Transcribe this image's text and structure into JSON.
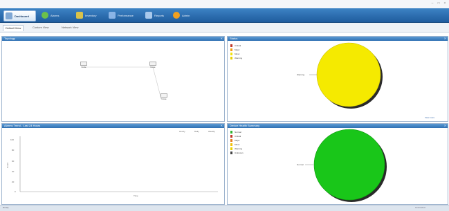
{
  "window": {
    "title_controls": [
      "–",
      "□",
      "×"
    ]
  },
  "toolbar": {
    "items": [
      {
        "label": "Dashboard",
        "icon": "dashboard-icon",
        "color": "#7fa7d4",
        "active": true
      },
      {
        "label": "Alarms",
        "icon": "alarms-icon",
        "color": "#6cc04a"
      },
      {
        "label": "Inventory",
        "icon": "inventory-icon",
        "color": "#d9c24a"
      },
      {
        "label": "Performance",
        "icon": "performance-icon",
        "color": "#8ab4e6"
      },
      {
        "label": "Reports",
        "icon": "reports-icon",
        "color": "#a9c9ec"
      },
      {
        "label": "Admin",
        "icon": "admin-icon",
        "color": "#f0a020"
      }
    ]
  },
  "subtabs": [
    "Default View",
    "Custom View",
    "Network View"
  ],
  "panels": {
    "topology": {
      "title": "Topology",
      "nodes": [
        {
          "label": "Node"
        },
        {
          "label": "Node"
        },
        {
          "label": "Node"
        }
      ]
    },
    "status_pie": {
      "title": "Status",
      "legend": [
        {
          "label": "Critical",
          "color": "#c0392b"
        },
        {
          "label": "Major",
          "color": "#f39c12"
        },
        {
          "label": "Minor",
          "color": "#f1e30f"
        },
        {
          "label": "Warning",
          "color": "#e8d000"
        }
      ],
      "slice_label": "Warning",
      "slice_color": "#f5ea00",
      "footer": "View more"
    },
    "trend": {
      "title": "Alarms Trend - Last 24 Hours",
      "controls": [
        "Hourly",
        "Daily",
        "Weekly"
      ],
      "y_ticks": [
        "100",
        "80",
        "60",
        "40",
        "20",
        "0"
      ],
      "x_label": "Time",
      "y_label": "Count"
    },
    "health_pie": {
      "title": "Device Health Summary",
      "legend": [
        {
          "label": "Normal",
          "color": "#2fb52f"
        },
        {
          "label": "Critical",
          "color": "#c0392b"
        },
        {
          "label": "Major",
          "color": "#e67e22"
        },
        {
          "label": "Minor",
          "color": "#f1c40f"
        },
        {
          "label": "Warning",
          "color": "#e8d000"
        },
        {
          "label": "Unknown",
          "color": "#444444"
        }
      ],
      "slice_label": "Normal",
      "slice_color": "#19c619"
    }
  },
  "statusbar": {
    "left": "Ready",
    "right": "Connected"
  }
}
